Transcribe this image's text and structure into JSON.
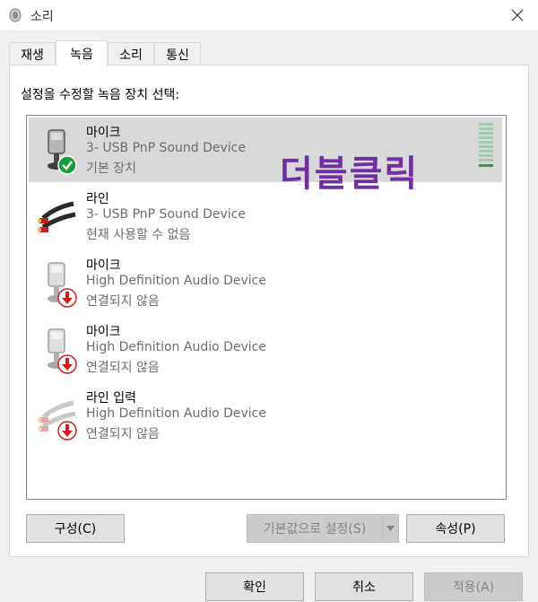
{
  "window": {
    "title": "소리"
  },
  "tabs": [
    {
      "label": "재생"
    },
    {
      "label": "녹음"
    },
    {
      "label": "소리"
    },
    {
      "label": "통신"
    }
  ],
  "panel": {
    "instruction": "설정을 수정할 녹음 장치 선택:"
  },
  "annotation": "더블클릭",
  "devices": [
    {
      "name": "마이크",
      "description": "3- USB PnP Sound Device",
      "status": "기본 장치"
    },
    {
      "name": "라인",
      "description": "3- USB PnP Sound Device",
      "status": "현재 사용할 수 없음"
    },
    {
      "name": "마이크",
      "description": "High Definition Audio Device",
      "status": "연결되지 않음"
    },
    {
      "name": "마이크",
      "description": "High Definition Audio Device",
      "status": "연결되지 않음"
    },
    {
      "name": "라인 입력",
      "description": "High Definition Audio Device",
      "status": "연결되지 않음"
    }
  ],
  "buttons": {
    "configure": "구성(C)",
    "set_default": "기본값으로 설정(S)",
    "properties": "속성(P)",
    "ok": "확인",
    "cancel": "취소",
    "apply": "적용(A)"
  },
  "colors": {
    "annotation": "#7030a0",
    "selected_row": "#d9d9d9",
    "level_active": "#2ea043",
    "status_check": "#1a9e3a",
    "status_disconnected": "#d11f1f"
  }
}
